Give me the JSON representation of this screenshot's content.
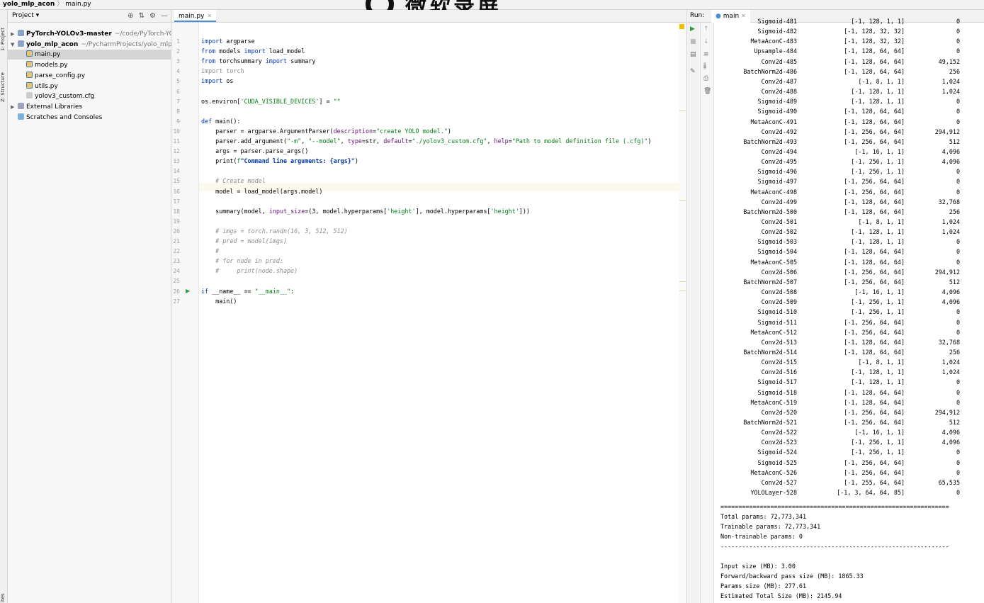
{
  "titlebar": {
    "project": "yolo_mlp_acon",
    "file": "main.py"
  },
  "watermark": {
    "text": "微软录屏"
  },
  "leftstrip": {
    "project_label": "1: Project",
    "structure_label": "Z: Structure",
    "bottom_label": "ites"
  },
  "project_panel": {
    "title": "Project",
    "items": [
      {
        "name": "PyTorch-YOLOv3-master",
        "path": "~/code/PyTorch-YOLOv",
        "kind": "folder",
        "depth": 0,
        "bold": true
      },
      {
        "name": "yolo_mlp_acon",
        "path": "~/PycharmProjects/yolo_mlp_acon",
        "kind": "folder",
        "depth": 0,
        "bold": true
      },
      {
        "name": "main.py",
        "path": "",
        "kind": "py",
        "depth": 1,
        "selected": true
      },
      {
        "name": "models.py",
        "path": "",
        "kind": "py",
        "depth": 1
      },
      {
        "name": "parse_config.py",
        "path": "",
        "kind": "py",
        "depth": 1
      },
      {
        "name": "utils.py",
        "path": "",
        "kind": "py",
        "depth": 1
      },
      {
        "name": "yolov3_custom.cfg",
        "path": "",
        "kind": "cfg",
        "depth": 1
      },
      {
        "name": "External Libraries",
        "path": "",
        "kind": "lib",
        "depth": 0
      },
      {
        "name": "Scratches and Consoles",
        "path": "",
        "kind": "scratch",
        "depth": 0
      }
    ]
  },
  "editor": {
    "tab": "main.py",
    "lines": [
      "import argparse",
      "from models import load_model",
      "from torchsummary import summary",
      "import torch",
      "import os",
      "",
      "os.environ['CUDA_VISIBLE_DEVICES'] = \"\"",
      "",
      "def main():",
      "    parser = argparse.ArgumentParser(description=\"create YOLO model.\")",
      "    parser.add_argument(\"-m\", \"--model\", type=str, default=\"./yolov3_custom.cfg\", help=\"Path to model definition file (.cfg)\")",
      "    args = parser.parse_args()",
      "    print(f\"Command line arguments: {args}\")",
      "",
      "    # Create model",
      "    model = load_model(args.model)",
      "",
      "    summary(model, input_size=(3, model.hyperparams['height'], model.hyperparams['height']))",
      "",
      "    # imgs = torch.randn(16, 3, 512, 512)",
      "    # pred = model(imgs)",
      "    #",
      "    # for node in pred:",
      "    #     print(node.shape)",
      "",
      "if __name__ == \"__main__\":",
      "    main()"
    ]
  },
  "run": {
    "label": "Run:",
    "tab": "main",
    "rows": [
      [
        "Sigmoid-481",
        "[-1, 128, 1, 1]",
        "0"
      ],
      [
        "Sigmoid-482",
        "[-1, 128, 32, 32]",
        "0"
      ],
      [
        "MetaAconC-483",
        "[-1, 128, 32, 32]",
        "0"
      ],
      [
        "Upsample-484",
        "[-1, 128, 64, 64]",
        "0"
      ],
      [
        "Conv2d-485",
        "[-1, 128, 64, 64]",
        "49,152"
      ],
      [
        "BatchNorm2d-486",
        "[-1, 128, 64, 64]",
        "256"
      ],
      [
        "Conv2d-487",
        "[-1, 8, 1, 1]",
        "1,024"
      ],
      [
        "Conv2d-488",
        "[-1, 128, 1, 1]",
        "1,024"
      ],
      [
        "Sigmoid-489",
        "[-1, 128, 1, 1]",
        "0"
      ],
      [
        "Sigmoid-490",
        "[-1, 128, 64, 64]",
        "0"
      ],
      [
        "MetaAconC-491",
        "[-1, 128, 64, 64]",
        "0"
      ],
      [
        "Conv2d-492",
        "[-1, 256, 64, 64]",
        "294,912"
      ],
      [
        "BatchNorm2d-493",
        "[-1, 256, 64, 64]",
        "512"
      ],
      [
        "Conv2d-494",
        "[-1, 16, 1, 1]",
        "4,096"
      ],
      [
        "Conv2d-495",
        "[-1, 256, 1, 1]",
        "4,096"
      ],
      [
        "Sigmoid-496",
        "[-1, 256, 1, 1]",
        "0"
      ],
      [
        "Sigmoid-497",
        "[-1, 256, 64, 64]",
        "0"
      ],
      [
        "MetaAconC-498",
        "[-1, 256, 64, 64]",
        "0"
      ],
      [
        "Conv2d-499",
        "[-1, 128, 64, 64]",
        "32,768"
      ],
      [
        "BatchNorm2d-500",
        "[-1, 128, 64, 64]",
        "256"
      ],
      [
        "Conv2d-501",
        "[-1, 8, 1, 1]",
        "1,024"
      ],
      [
        "Conv2d-502",
        "[-1, 128, 1, 1]",
        "1,024"
      ],
      [
        "Sigmoid-503",
        "[-1, 128, 1, 1]",
        "0"
      ],
      [
        "Sigmoid-504",
        "[-1, 128, 64, 64]",
        "0"
      ],
      [
        "MetaAconC-505",
        "[-1, 128, 64, 64]",
        "0"
      ],
      [
        "Conv2d-506",
        "[-1, 256, 64, 64]",
        "294,912"
      ],
      [
        "BatchNorm2d-507",
        "[-1, 256, 64, 64]",
        "512"
      ],
      [
        "Conv2d-508",
        "[-1, 16, 1, 1]",
        "4,096"
      ],
      [
        "Conv2d-509",
        "[-1, 256, 1, 1]",
        "4,096"
      ],
      [
        "Sigmoid-510",
        "[-1, 256, 1, 1]",
        "0"
      ],
      [
        "Sigmoid-511",
        "[-1, 256, 64, 64]",
        "0"
      ],
      [
        "MetaAconC-512",
        "[-1, 256, 64, 64]",
        "0"
      ],
      [
        "Conv2d-513",
        "[-1, 128, 64, 64]",
        "32,768"
      ],
      [
        "BatchNorm2d-514",
        "[-1, 128, 64, 64]",
        "256"
      ],
      [
        "Conv2d-515",
        "[-1, 8, 1, 1]",
        "1,024"
      ],
      [
        "Conv2d-516",
        "[-1, 128, 1, 1]",
        "1,024"
      ],
      [
        "Sigmoid-517",
        "[-1, 128, 1, 1]",
        "0"
      ],
      [
        "Sigmoid-518",
        "[-1, 128, 64, 64]",
        "0"
      ],
      [
        "MetaAconC-519",
        "[-1, 128, 64, 64]",
        "0"
      ],
      [
        "Conv2d-520",
        "[-1, 256, 64, 64]",
        "294,912"
      ],
      [
        "BatchNorm2d-521",
        "[-1, 256, 64, 64]",
        "512"
      ],
      [
        "Conv2d-522",
        "[-1, 16, 1, 1]",
        "4,096"
      ],
      [
        "Conv2d-523",
        "[-1, 256, 1, 1]",
        "4,096"
      ],
      [
        "Sigmoid-524",
        "[-1, 256, 1, 1]",
        "0"
      ],
      [
        "Sigmoid-525",
        "[-1, 256, 64, 64]",
        "0"
      ],
      [
        "MetaAconC-526",
        "[-1, 256, 64, 64]",
        "0"
      ],
      [
        "Conv2d-527",
        "[-1, 255, 64, 64]",
        "65,535"
      ],
      [
        "YOLOLayer-528",
        "[-1, 3, 64, 64, 85]",
        "0"
      ]
    ],
    "separator_eq": "================================================================",
    "separator_dash": "----------------------------------------------------------------",
    "totals": [
      "Total params: 72,773,341",
      "Trainable params: 72,773,341",
      "Non-trainable params: 0"
    ],
    "sizes": [
      "Input size (MB): 3.00",
      "Forward/backward pass size (MB): 1865.33",
      "Params size (MB): 277.61",
      "Estimated Total Size (MB): 2145.94"
    ]
  }
}
